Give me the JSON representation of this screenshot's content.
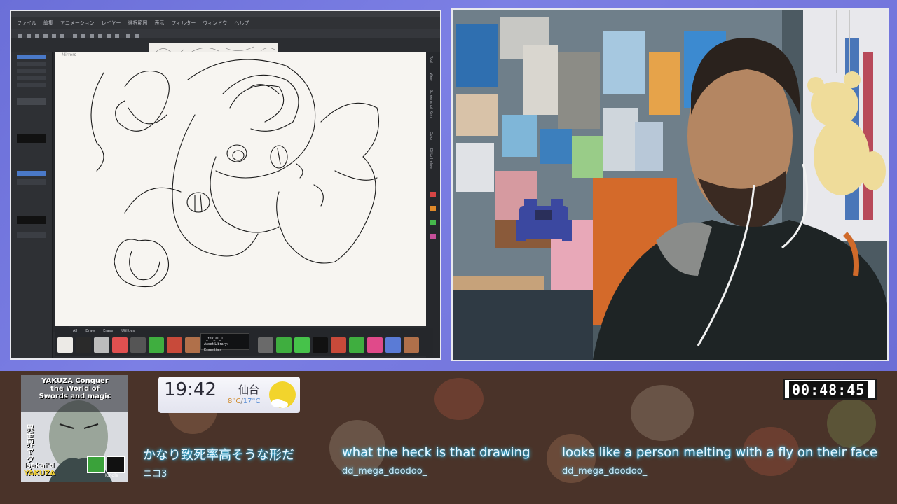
{
  "drawing_app": {
    "menu_items": [
      "ファイル",
      "編集",
      "アニメーション",
      "レイヤー",
      "選択範囲",
      "表示",
      "フィルター",
      "ウィンドウ",
      "ヘルプ"
    ],
    "canvas_label": "Mirrors",
    "brush_tabs": [
      "All",
      "Draw",
      "Erase",
      "Utilities"
    ],
    "tooltip": {
      "title": "1_tex_ail_1",
      "subtitle": "Asset Library: Essentials"
    },
    "dock_labels": [
      "Tool",
      "View",
      "Screenshot Keys",
      "Color",
      "Ditto Helper"
    ]
  },
  "cover": {
    "title_line1": "YAKUZA Conquer",
    "title_line2": "the World of",
    "title_line3": "Swords and magic",
    "vertical_jp": "異世界ヤクザ",
    "bottom_label_1": "Isekai'd",
    "bottom_label_2": "YAKUZA",
    "kindle_label": "Kindle"
  },
  "clock": {
    "time": "19:42",
    "city": "仙台",
    "temp_high": "8°C",
    "temp_separator": "/",
    "temp_low": "17°C",
    "weather_icon": "sun-cloud-icon"
  },
  "timer": {
    "value": "00:48:45"
  },
  "chat": [
    {
      "message": "かなり致死率高そうな形だ",
      "user": "ニコ3"
    },
    {
      "message": "what the heck is that drawing",
      "user": "dd_mega_doodoo_"
    },
    {
      "message": "looks like a person melting with a fly on their face",
      "user": "dd_mega_doodoo_"
    }
  ],
  "colors": {
    "frame_purple": "#6b6fd8",
    "bottom_brown": "#4a3329",
    "chat_glow": "#34d8ff"
  }
}
